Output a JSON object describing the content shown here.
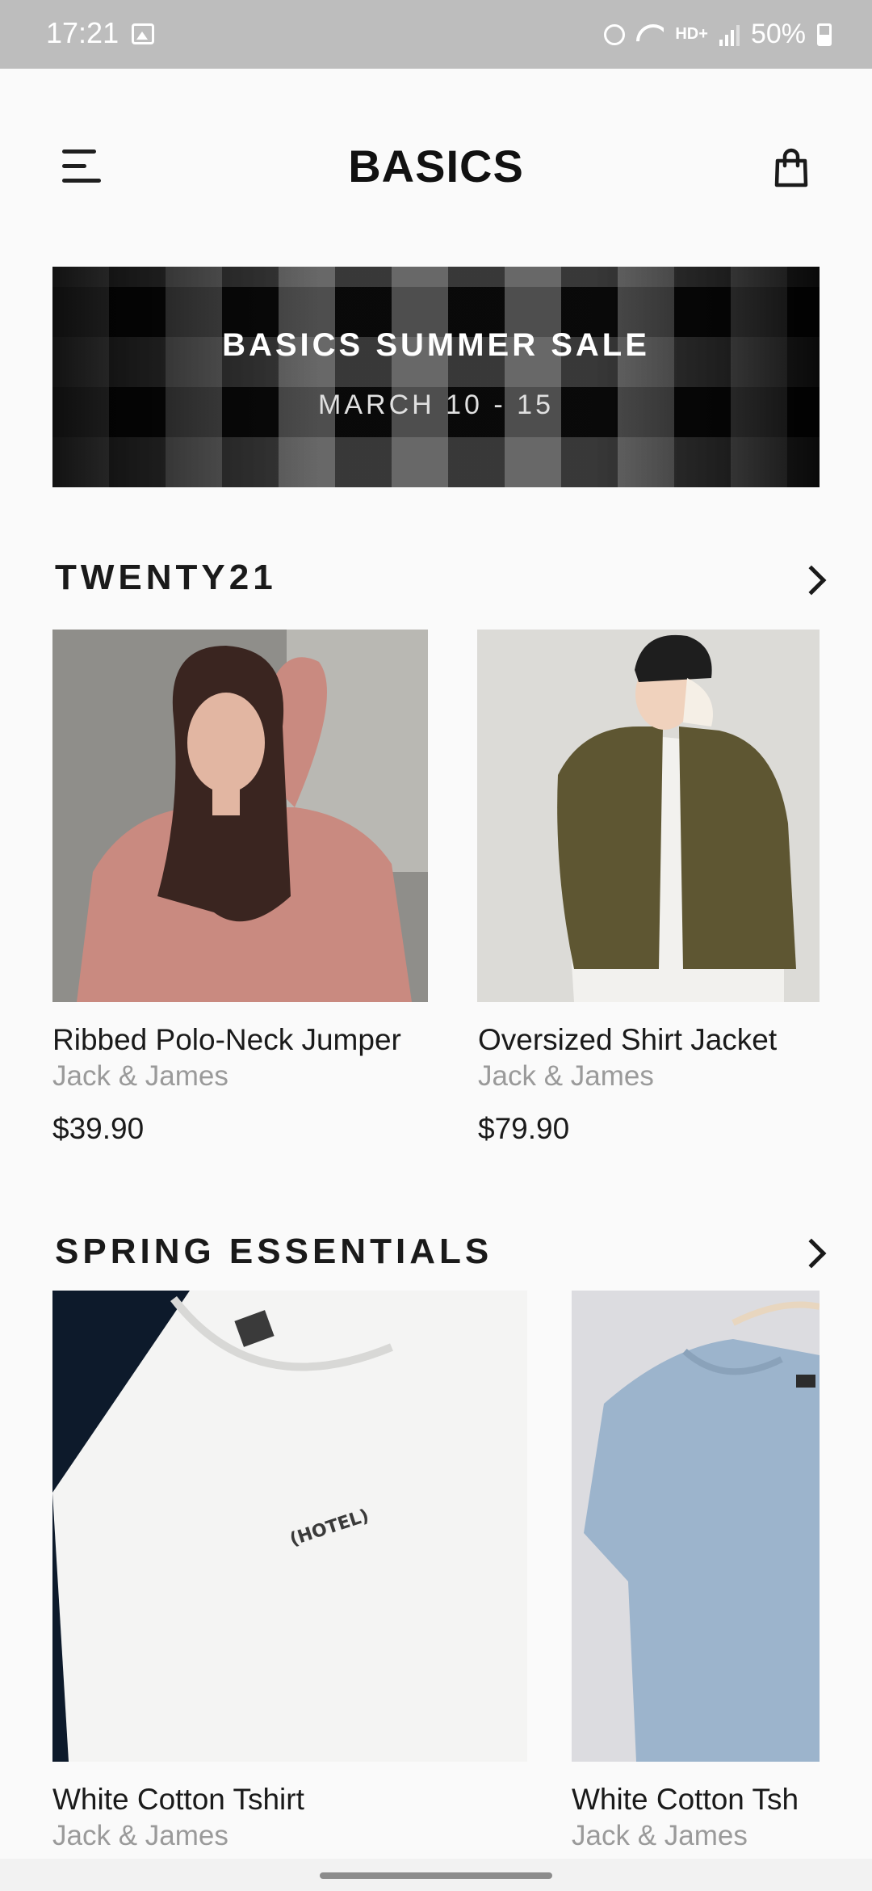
{
  "status_bar": {
    "time": "17:21",
    "network": "HD+",
    "battery": "50%"
  },
  "header": {
    "title": "BASICS",
    "menu_icon": "hamburger-menu-icon",
    "bag_icon": "shopping-bag-icon"
  },
  "banner": {
    "title": "BASICS SUMMER SALE",
    "subtitle": "MARCH 10 - 15"
  },
  "sections": [
    {
      "title": "TWENTY21",
      "products": [
        {
          "name": "Ribbed Polo-Neck Jumper",
          "brand": "Jack & James",
          "price": "$39.90"
        },
        {
          "name": "Oversized Shirt Jacket",
          "brand": "Jack & James",
          "price": "$79.90"
        }
      ]
    },
    {
      "title": "SPRING ESSENTIALS",
      "products": [
        {
          "name": "White Cotton Tshirt",
          "brand": "Jack & James",
          "shirt_print": "(HOTEL)"
        },
        {
          "name": "White Cotton Tsh",
          "brand": "Jack & James"
        }
      ]
    }
  ],
  "colors": {
    "background": "#fafafa",
    "text": "#1a1a1a",
    "muted_text": "#9a9a9a",
    "status_bar": "#bdbdbd"
  }
}
